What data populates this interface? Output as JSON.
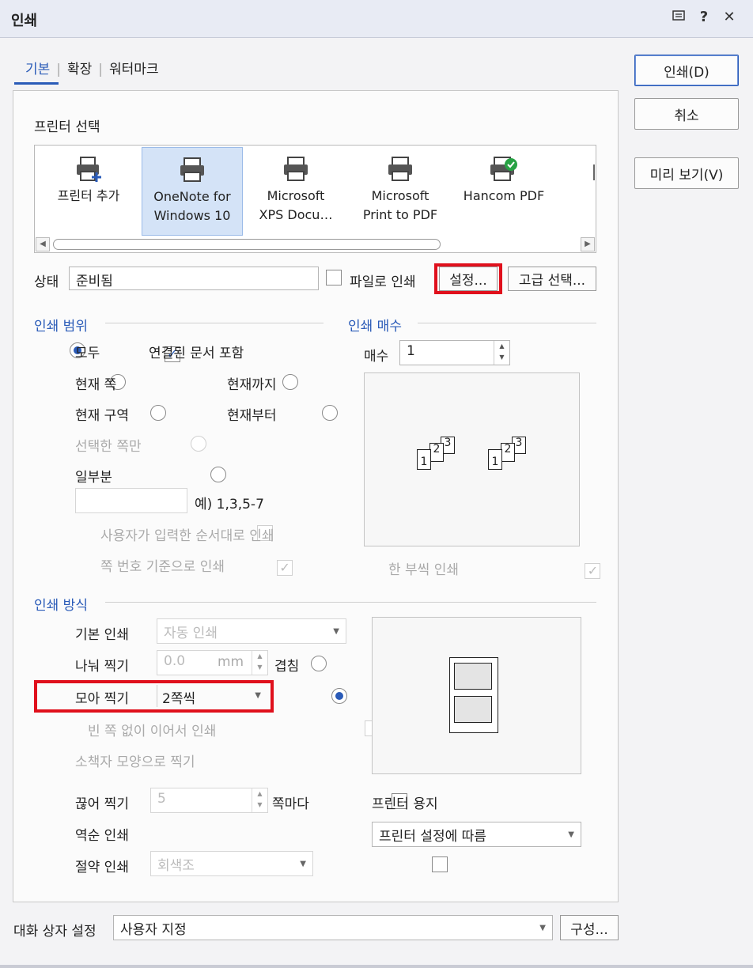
{
  "window": {
    "title": "인쇄",
    "help_glyph": "?",
    "close_glyph": "✕"
  },
  "tabs": [
    {
      "label": "기본"
    },
    {
      "label": "확장"
    },
    {
      "label": "워터마크"
    }
  ],
  "tab_separator": "|",
  "buttons": {
    "print": "인쇄(D)",
    "cancel": "취소",
    "preview": "미리 보기(V)"
  },
  "printer_select": {
    "label": "프린터 선택",
    "printers": [
      {
        "name_line1": "프린터 추가",
        "name_line2": "",
        "icon": "printer-add-icon"
      },
      {
        "name_line1": "OneNote for",
        "name_line2": "Windows 10",
        "icon": "printer-icon",
        "selected": true
      },
      {
        "name_line1": "Microsoft",
        "name_line2": "XPS Docu…",
        "icon": "printer-icon"
      },
      {
        "name_line1": "Microsoft",
        "name_line2": "Print to PDF",
        "icon": "printer-icon"
      },
      {
        "name_line1": "Hancom PDF",
        "name_line2": "",
        "icon": "printer-check-icon"
      }
    ]
  },
  "status": {
    "label": "상태",
    "value": "준비됨",
    "print_to_file": "파일로 인쇄",
    "settings": "설정...",
    "advanced": "고급 선택..."
  },
  "range": {
    "heading": "인쇄 범위",
    "all": "모두",
    "include_linked": "연결된 문서 포함",
    "current_page": "현재 쪽",
    "to_current": "현재까지",
    "current_section": "현재 구역",
    "from_current": "현재부터",
    "selected_pages": "선택한 쪽만",
    "partial": "일부분",
    "partial_hint": "예) 1,3,5-7",
    "user_order": "사용자가 입력한 순서대로 인쇄",
    "by_page_number": "쪽 번호 기준으로 인쇄"
  },
  "copies": {
    "heading": "인쇄 매수",
    "label": "매수",
    "value": "1",
    "collate": "한 부씩 인쇄",
    "pages_a": [
      "1",
      "2",
      "3"
    ],
    "pages_b": [
      "1",
      "2",
      "3"
    ]
  },
  "method": {
    "heading": "인쇄 방식",
    "basic": "기본 인쇄",
    "basic_value": "자동 인쇄",
    "tile": "나눠 찍기",
    "tile_value": "0.0",
    "tile_unit": "mm",
    "overlap": "겹침",
    "nup": "모아 찍기",
    "nup_value": "2쪽씩",
    "no_blank": "빈 쪽 없이 이어서 인쇄",
    "booklet": "소책자 모양으로 찍기",
    "split": "끊어 찍기",
    "split_value": "5",
    "split_suffix": "쪽마다",
    "reverse": "역순 인쇄",
    "save": "절약 인쇄",
    "save_value": "회색조"
  },
  "paper": {
    "label": "프린터 용지",
    "value": "프린터 설정에 따름"
  },
  "dialog_settings": {
    "label": "대화 상자 설정",
    "value": "사용자 지정",
    "configure": "구성..."
  },
  "colors": {
    "accent": "#2a5bb8",
    "highlight": "#e0101c"
  }
}
